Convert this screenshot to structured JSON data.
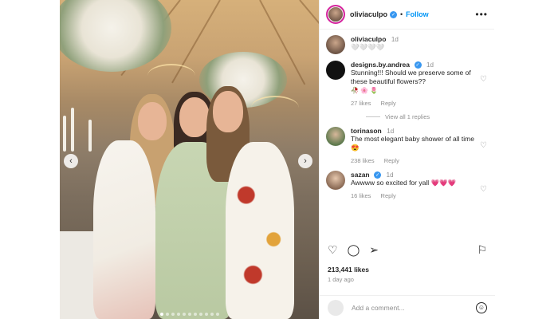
{
  "post": {
    "username": "oliviaculpo",
    "follow_label": "Follow",
    "more_icon": "more-horizontal-icon",
    "caption_time": "1d",
    "caption_hearts": "🤍🤍🤍🤍",
    "likes": "213,441 likes",
    "posted_ago": "1 day ago"
  },
  "comments": [
    {
      "username": "designs.by.andrea",
      "time": "1d",
      "text": "Stunning!!! Should we preserve some of these beautiful flowers??",
      "emoji": "🥀 🌸 🌷",
      "likes": "27 likes",
      "reply_label": "Reply"
    },
    {
      "username": "torinason",
      "time": "1d",
      "text": "The most elegant baby shower of all time 😍",
      "likes": "238 likes",
      "reply_label": "Reply"
    },
    {
      "username": "sazan",
      "time": "1d",
      "text": "Awwww so excited for yall 💗💗💗",
      "likes": "16 likes",
      "reply_label": "Reply"
    }
  ],
  "view_replies": "View all 1 replies",
  "composer": {
    "placeholder": "Add a comment..."
  },
  "carousel": {
    "dot_count": 11,
    "active_index": 0
  },
  "colors": {
    "accent": "#0095f6",
    "verified": "#3897f0"
  }
}
